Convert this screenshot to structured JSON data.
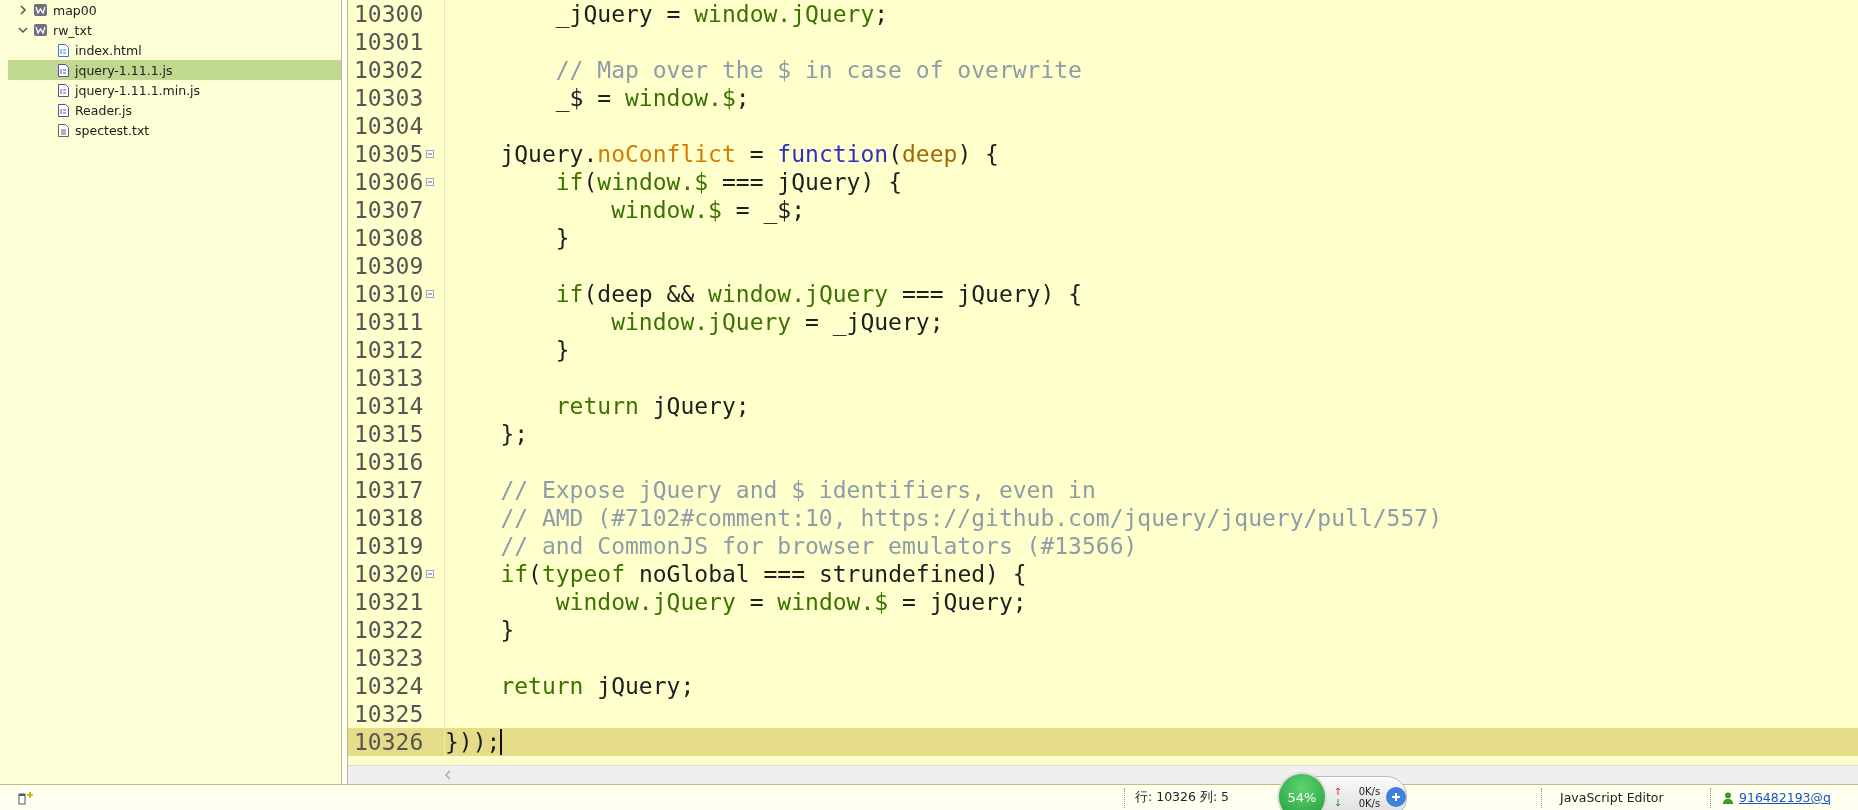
{
  "sidebar": {
    "items": [
      {
        "label": "map00",
        "kind": "project",
        "expanded": false,
        "selected": false
      },
      {
        "label": "rw_txt",
        "kind": "project",
        "expanded": true,
        "selected": false,
        "children": [
          {
            "label": "index.html",
            "kind": "html",
            "selected": false
          },
          {
            "label": "jquery-1.11.1.js",
            "kind": "js",
            "selected": true
          },
          {
            "label": "jquery-1.11.1.min.js",
            "kind": "js",
            "selected": false
          },
          {
            "label": "Reader.js",
            "kind": "js",
            "selected": false
          },
          {
            "label": "spectest.txt",
            "kind": "txt",
            "selected": false
          }
        ]
      }
    ]
  },
  "editor": {
    "lines": [
      {
        "number": "10300",
        "foldable": false,
        "current": false,
        "tokens": [
          {
            "kind": "text",
            "text": "        _jQuery = "
          },
          {
            "kind": "global",
            "text": "window.jQuery"
          },
          {
            "kind": "text",
            "text": ";"
          }
        ]
      },
      {
        "number": "10301",
        "foldable": false,
        "current": false
      },
      {
        "number": "10302",
        "foldable": false,
        "current": false,
        "tokens": [
          {
            "kind": "comment",
            "text": "        // Map over the $ in case of overwrite"
          }
        ]
      },
      {
        "number": "10303",
        "foldable": false,
        "current": false,
        "tokens": [
          {
            "kind": "text",
            "text": "        _$ = "
          },
          {
            "kind": "global",
            "text": "window.$"
          },
          {
            "kind": "text",
            "text": ";"
          }
        ]
      },
      {
        "number": "10304",
        "foldable": false,
        "current": false
      },
      {
        "number": "10305",
        "foldable": true,
        "current": false,
        "tokens": [
          {
            "kind": "text",
            "text": "    jQuery."
          },
          {
            "kind": "property",
            "text": "noConflict"
          },
          {
            "kind": "text",
            "text": " = "
          },
          {
            "kind": "function",
            "text": "function"
          },
          {
            "kind": "text",
            "text": "("
          },
          {
            "kind": "param",
            "text": "deep"
          },
          {
            "kind": "text",
            "text": ") {"
          }
        ]
      },
      {
        "number": "10306",
        "foldable": true,
        "current": false,
        "tokens": [
          {
            "kind": "keyword",
            "text": "        if"
          },
          {
            "kind": "text",
            "text": "("
          },
          {
            "kind": "global",
            "text": "window.$"
          },
          {
            "kind": "text",
            "text": " === jQuery) {"
          }
        ]
      },
      {
        "number": "10307",
        "foldable": false,
        "current": false,
        "tokens": [
          {
            "kind": "global",
            "text": "            window.$"
          },
          {
            "kind": "text",
            "text": " = _$;"
          }
        ]
      },
      {
        "number": "10308",
        "foldable": false,
        "current": false,
        "tokens": [
          {
            "kind": "text",
            "text": "        }"
          }
        ]
      },
      {
        "number": "10309",
        "foldable": false,
        "current": false
      },
      {
        "number": "10310",
        "foldable": true,
        "current": false,
        "tokens": [
          {
            "kind": "keyword",
            "text": "        if"
          },
          {
            "kind": "text",
            "text": "(deep && "
          },
          {
            "kind": "global",
            "text": "window.jQuery"
          },
          {
            "kind": "text",
            "text": " === jQuery) {"
          }
        ]
      },
      {
        "number": "10311",
        "foldable": false,
        "current": false,
        "tokens": [
          {
            "kind": "global",
            "text": "            window.jQuery"
          },
          {
            "kind": "text",
            "text": " = _jQuery;"
          }
        ]
      },
      {
        "number": "10312",
        "foldable": false,
        "current": false,
        "tokens": [
          {
            "kind": "text",
            "text": "        }"
          }
        ]
      },
      {
        "number": "10313",
        "foldable": false,
        "current": false
      },
      {
        "number": "10314",
        "foldable": false,
        "current": false,
        "tokens": [
          {
            "kind": "keyword",
            "text": "        return"
          },
          {
            "kind": "text",
            "text": " jQuery;"
          }
        ]
      },
      {
        "number": "10315",
        "foldable": false,
        "current": false,
        "tokens": [
          {
            "kind": "text",
            "text": "    };"
          }
        ]
      },
      {
        "number": "10316",
        "foldable": false,
        "current": false
      },
      {
        "number": "10317",
        "foldable": false,
        "current": false,
        "tokens": [
          {
            "kind": "comment",
            "text": "    // Expose jQuery and $ identifiers, even in"
          }
        ]
      },
      {
        "number": "10318",
        "foldable": false,
        "current": false,
        "tokens": [
          {
            "kind": "comment",
            "text": "    // AMD (#7102#comment:10, https://github.com/jquery/jquery/pull/557)"
          }
        ]
      },
      {
        "number": "10319",
        "foldable": false,
        "current": false,
        "tokens": [
          {
            "kind": "comment",
            "text": "    // and CommonJS for browser emulators (#13566)"
          }
        ]
      },
      {
        "number": "10320",
        "foldable": true,
        "current": false,
        "tokens": [
          {
            "kind": "keyword",
            "text": "    if"
          },
          {
            "kind": "text",
            "text": "("
          },
          {
            "kind": "keyword",
            "text": "typeof"
          },
          {
            "kind": "text",
            "text": " noGlobal === strundefined) {"
          }
        ]
      },
      {
        "number": "10321",
        "foldable": false,
        "current": false,
        "tokens": [
          {
            "kind": "global",
            "text": "        window.jQuery"
          },
          {
            "kind": "text",
            "text": " = "
          },
          {
            "kind": "global",
            "text": "window.$"
          },
          {
            "kind": "text",
            "text": " = jQuery;"
          }
        ]
      },
      {
        "number": "10322",
        "foldable": false,
        "current": false,
        "tokens": [
          {
            "kind": "text",
            "text": "    }"
          }
        ]
      },
      {
        "number": "10323",
        "foldable": false,
        "current": false
      },
      {
        "number": "10324",
        "foldable": false,
        "current": false,
        "tokens": [
          {
            "kind": "keyword",
            "text": "    return"
          },
          {
            "kind": "text",
            "text": " jQuery;"
          }
        ]
      },
      {
        "number": "10325",
        "foldable": false,
        "current": false
      },
      {
        "number": "10326",
        "foldable": false,
        "current": true,
        "tokens": [
          {
            "kind": "text",
            "text": "}));"
          }
        ]
      }
    ]
  },
  "status_bar": {
    "position": "行: 10326 列: 5",
    "monitor": {
      "percent": "54%",
      "upload": "0K/s",
      "download": "0K/s"
    },
    "editor_type": "JavaScript Editor",
    "user": "916482193@q"
  }
}
